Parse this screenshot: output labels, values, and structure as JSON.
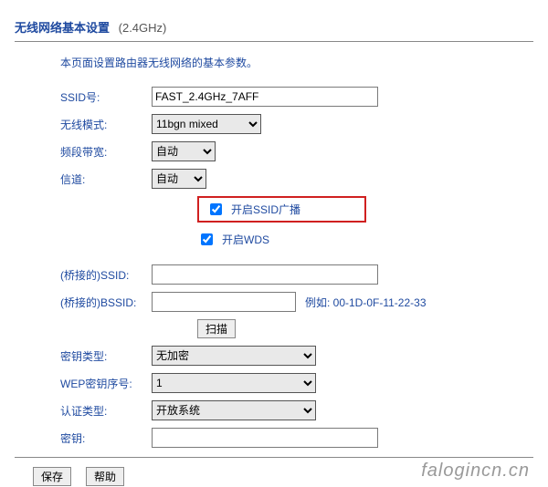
{
  "header": {
    "title": "无线网络基本设置",
    "band": "(2.4GHz)"
  },
  "intro": "本页面设置路由器无线网络的基本参数。",
  "fields": {
    "ssid": {
      "label": "SSID号:",
      "value": "FAST_2.4GHz_7AFF"
    },
    "mode": {
      "label": "无线模式:",
      "value": "11bgn mixed"
    },
    "bandwidth": {
      "label": "频段带宽:",
      "value": "自动"
    },
    "channel": {
      "label": "信道:",
      "value": "自动"
    },
    "enable_ssid": {
      "label": "开启SSID广播",
      "checked": true
    },
    "enable_wds": {
      "label": "开启WDS",
      "checked": true
    },
    "bridge_ssid": {
      "label": "(桥接的)SSID:",
      "value": ""
    },
    "bridge_bssid": {
      "label": "(桥接的)BSSID:",
      "value": "",
      "hint": "例如: 00-1D-0F-11-22-33"
    },
    "scan": "扫描",
    "key_type": {
      "label": "密钥类型:",
      "value": "无加密"
    },
    "wep_index": {
      "label": "WEP密钥序号:",
      "value": "1"
    },
    "auth_type": {
      "label": "认证类型:",
      "value": "开放系统"
    },
    "key": {
      "label": "密钥:",
      "value": ""
    }
  },
  "buttons": {
    "save": "保存",
    "help": "帮助"
  },
  "watermark": "falogincn.cn"
}
